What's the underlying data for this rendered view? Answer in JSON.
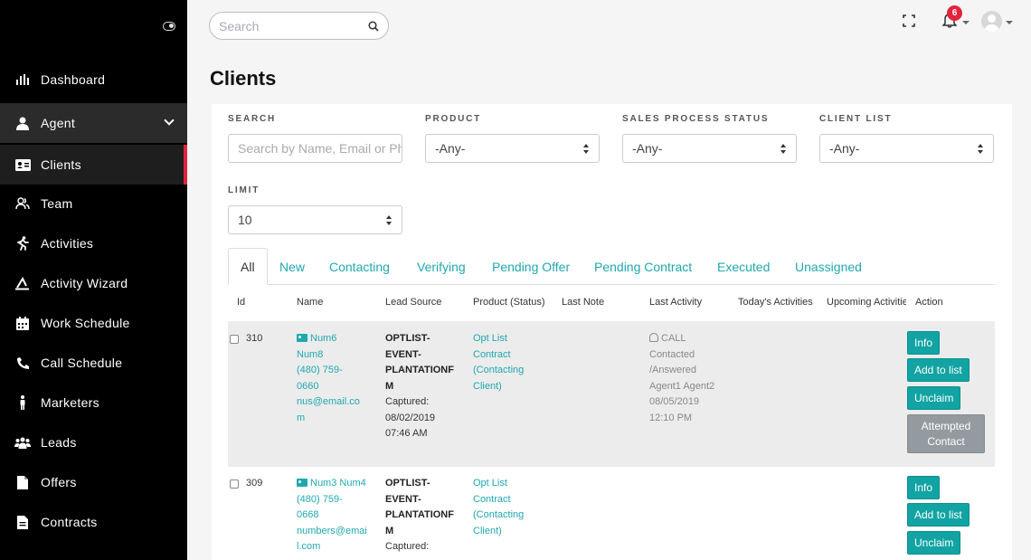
{
  "sidebar": {
    "items": [
      {
        "label": "Dashboard",
        "icon": "bar-chart-icon"
      },
      {
        "label": "Agent",
        "icon": "user-icon"
      },
      {
        "label": "Clients",
        "icon": "id-card-icon"
      },
      {
        "label": "Team",
        "icon": "users-icon"
      },
      {
        "label": "Activities",
        "icon": "running-icon"
      },
      {
        "label": "Activity Wizard",
        "icon": "magic-icon"
      },
      {
        "label": "Work Schedule",
        "icon": "calendar-icon"
      },
      {
        "label": "Call Schedule",
        "icon": "phone-icon"
      },
      {
        "label": "Marketers",
        "icon": "person-icon"
      },
      {
        "label": "Leads",
        "icon": "group-icon"
      },
      {
        "label": "Offers",
        "icon": "file-icon"
      },
      {
        "label": "Contracts",
        "icon": "file-text-icon"
      }
    ]
  },
  "topbar": {
    "search_placeholder": "Search",
    "notification_count": "6"
  },
  "page": {
    "title": "Clients"
  },
  "filters": {
    "search_label": "SEARCH",
    "search_placeholder": "Search by Name, Email or Phone",
    "product_label": "PRODUCT",
    "product_value": "-Any-",
    "sales_label": "SALES PROCESS STATUS",
    "sales_value": "-Any-",
    "client_list_label": "CLIENT LIST",
    "client_list_value": "-Any-",
    "limit_label": "LIMIT",
    "limit_value": "10"
  },
  "tabs": [
    "All",
    "New",
    "Contacting",
    "Verifying",
    "Pending Offer",
    "Pending Contract",
    "Executed",
    "Unassigned"
  ],
  "table": {
    "headers": [
      "Id",
      "Name",
      "Lead Source",
      "Product (Status)",
      "Last Note",
      "Last Activity",
      "Today's Activities",
      "Upcoming Activities",
      "Action"
    ],
    "rows": [
      {
        "id": "310",
        "name_lines": [
          "Num6",
          "Num8",
          "(480) 759-",
          "0660",
          "nus@email.co",
          "m"
        ],
        "source_lines": [
          "OPTLIST-",
          "EVENT-",
          "PLANTATIONF",
          "M"
        ],
        "captured_lines": [
          "Captured:",
          "08/02/2019",
          "07:46 AM"
        ],
        "product_lines": [
          "Opt List",
          "Contract",
          "(Contacting",
          "Client)"
        ],
        "activity_lines": [
          "CALL",
          "Contacted",
          "/Answered",
          "Agent1 Agent2",
          "08/05/2019",
          "12:10 PM"
        ],
        "buttons": [
          "Info",
          "Add to list",
          "Unclaim",
          "Attempted Contact"
        ]
      },
      {
        "id": "309",
        "name_lines": [
          "Num3 Num4",
          "(480) 759-",
          "0668",
          "numbers@emai",
          "l.com"
        ],
        "source_lines": [
          "OPTLIST-",
          "EVENT-",
          "PLANTATIONF",
          "M"
        ],
        "captured_lines": [
          "Captured:"
        ],
        "product_lines": [
          "Opt List",
          "Contract",
          "(Contacting",
          "Client)"
        ],
        "activity_lines": [],
        "buttons": [
          "Info",
          "Add to list",
          "Unclaim"
        ]
      }
    ]
  }
}
